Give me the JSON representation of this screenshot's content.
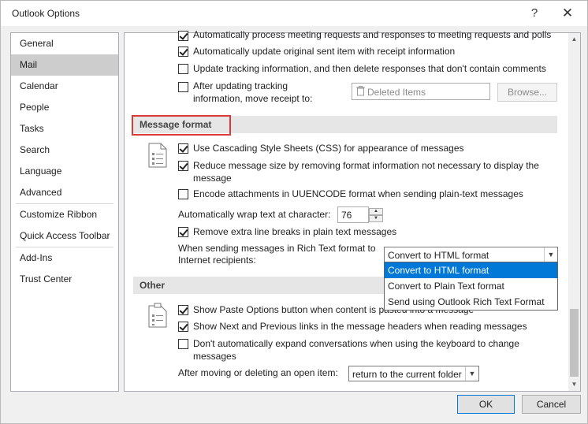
{
  "window": {
    "title": "Outlook Options",
    "help_icon": "?",
    "close_icon": "✕"
  },
  "nav": {
    "items": [
      {
        "label": "General"
      },
      {
        "label": "Mail"
      },
      {
        "label": "Calendar"
      },
      {
        "label": "People"
      },
      {
        "label": "Tasks"
      },
      {
        "label": "Search"
      },
      {
        "label": "Language"
      },
      {
        "label": "Advanced"
      },
      {
        "label": "Customize Ribbon"
      },
      {
        "label": "Quick Access Toolbar"
      },
      {
        "label": "Add-Ins"
      },
      {
        "label": "Trust Center"
      }
    ],
    "selected": "Mail"
  },
  "tracking": {
    "process_requests": {
      "label": "Automatically process meeting requests and responses to meeting requests and polls",
      "checked": true
    },
    "update_sent": {
      "label": "Automatically update original sent item with receipt information",
      "checked": true
    },
    "update_delete": {
      "label": "Update tracking information, and then delete responses that don't contain comments",
      "checked": false
    },
    "move_receipt": {
      "label_line1": "After updating tracking",
      "label_line2": "information, move receipt to:",
      "checked": false
    },
    "folder_value": "Deleted Items",
    "browse_label": "Browse..."
  },
  "message_format": {
    "header": "Message format",
    "use_css": {
      "label": "Use Cascading Style Sheets (CSS) for appearance of messages",
      "checked": true
    },
    "reduce_size": {
      "label_line1": "Reduce message size by removing format information not necessary to display the",
      "label_line2": "message",
      "checked": true
    },
    "uuencode": {
      "label": "Encode attachments in UUENCODE format when sending plain-text messages",
      "checked": false
    },
    "wrap_label": "Automatically wrap text at character:",
    "wrap_value": "76",
    "remove_breaks": {
      "label": "Remove extra line breaks in plain text messages",
      "checked": true
    },
    "rtf_label_line1": "When sending messages in Rich Text format to",
    "rtf_label_line2": "Internet recipients:",
    "rtf_selected": "Convert to HTML format",
    "rtf_options": [
      "Convert to HTML format",
      "Convert to Plain Text format",
      "Send using Outlook Rich Text Format"
    ]
  },
  "other": {
    "header": "Other",
    "paste_options": {
      "label": "Show Paste Options button when content is pasted into a message",
      "checked": true
    },
    "next_prev": {
      "label": "Show Next and Previous links in the message headers when reading messages",
      "checked": true
    },
    "no_expand": {
      "label_line1": "Don't automatically expand conversations when using the keyboard to change",
      "label_line2": "messages",
      "checked": false
    },
    "after_move_label": "After moving or deleting an open item:",
    "after_move_value": "return to the current folder"
  },
  "footer": {
    "ok_label": "OK",
    "cancel_label": "Cancel"
  },
  "colors": {
    "accent": "#0078d7",
    "highlight_box": "#d93b3b",
    "nav_selected": "#cdcdcd"
  }
}
